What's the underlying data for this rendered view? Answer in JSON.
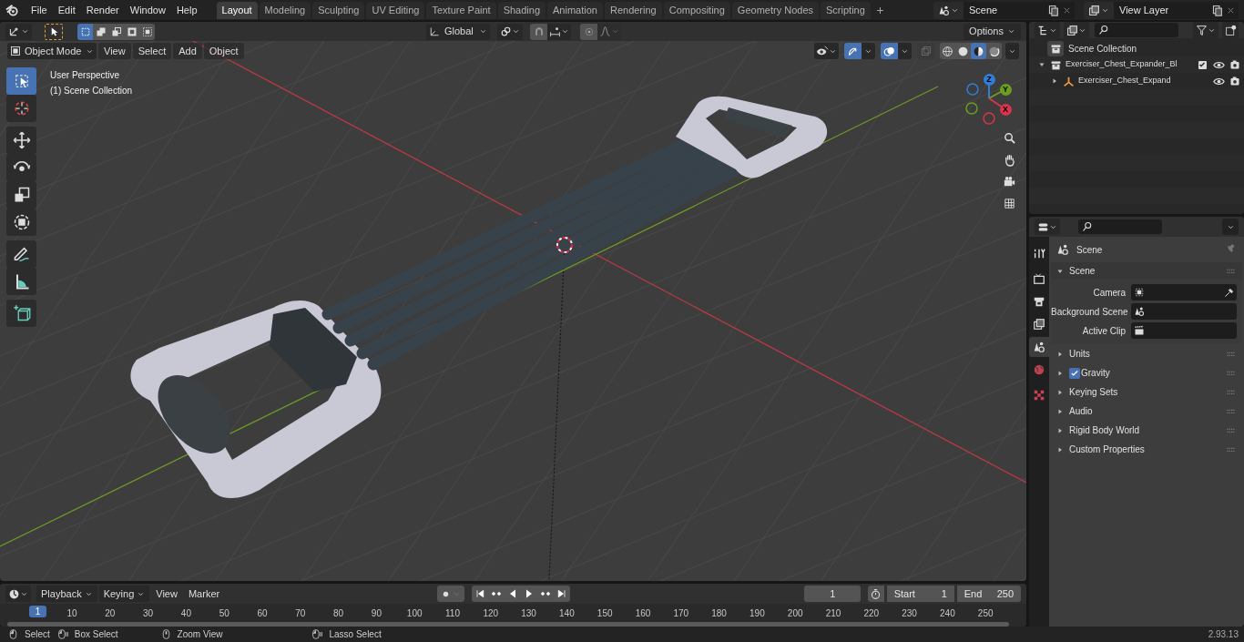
{
  "top_menu": [
    "File",
    "Edit",
    "Render",
    "Window",
    "Help"
  ],
  "workspaces": [
    {
      "label": "Layout",
      "selected": true
    },
    {
      "label": "Modeling",
      "selected": false
    },
    {
      "label": "Sculpting",
      "selected": false
    },
    {
      "label": "UV Editing",
      "selected": false
    },
    {
      "label": "Texture Paint",
      "selected": false
    },
    {
      "label": "Shading",
      "selected": false
    },
    {
      "label": "Animation",
      "selected": false
    },
    {
      "label": "Rendering",
      "selected": false
    },
    {
      "label": "Compositing",
      "selected": false
    },
    {
      "label": "Geometry Nodes",
      "selected": false
    },
    {
      "label": "Scripting",
      "selected": false
    }
  ],
  "scene_field": "Scene",
  "view_layer_field": "View Layer",
  "viewport": {
    "select_modes": [
      {
        "selected": true
      },
      {
        "selected": false
      },
      {
        "selected": false
      },
      {
        "selected": false
      },
      {
        "selected": false
      }
    ],
    "mode": "Object Mode",
    "menus": [
      "View",
      "Select",
      "Add",
      "Object"
    ],
    "orientation": "Global",
    "options": "Options",
    "info": [
      "User Perspective",
      "(1) Scene Collection"
    ],
    "tools": [
      {
        "kind": "select",
        "selected": true
      },
      {
        "kind": "cursor",
        "selected": false
      },
      {
        "kind": "move",
        "selected": false
      },
      {
        "kind": "rotate",
        "selected": false
      },
      {
        "kind": "scale",
        "selected": false
      },
      {
        "kind": "transform",
        "selected": false
      },
      {
        "kind": "annotate",
        "selected": false
      },
      {
        "kind": "measure",
        "selected": false
      },
      {
        "kind": "add-cube",
        "selected": false
      }
    ],
    "shading": [
      {
        "kind": "wireframe",
        "selected": false
      },
      {
        "kind": "solid",
        "selected": false
      },
      {
        "kind": "material",
        "selected": true
      },
      {
        "kind": "rendered",
        "selected": false
      }
    ],
    "axes": [
      {
        "label": "Z",
        "color": "#2f7fd8"
      },
      {
        "label": "Y",
        "color": "#6b9e1f"
      },
      {
        "label": "X",
        "color": "#d9344a"
      }
    ]
  },
  "outliner": {
    "root": "Scene Collection",
    "children": [
      {
        "label": "Exerciser_Chest_Expander_Bl",
        "kind": "collection",
        "expanded": true,
        "checked": true,
        "children": [
          {
            "label": "Exerciser_Chest_Expand",
            "kind": "empty",
            "expanded": false
          }
        ]
      }
    ]
  },
  "properties": {
    "tabs": [
      {
        "kind": "tool",
        "selected": false
      },
      {
        "kind": "render",
        "selected": false
      },
      {
        "kind": "output",
        "selected": false
      },
      {
        "kind": "view-layer",
        "selected": false
      },
      {
        "kind": "scene",
        "selected": true
      },
      {
        "kind": "world",
        "selected": false
      },
      {
        "kind": "texture",
        "selected": false
      }
    ],
    "context": "Scene",
    "panels": [
      {
        "label": "Scene",
        "expanded": true,
        "fields": [
          {
            "label": "Camera",
            "kind": "camera"
          },
          {
            "label": "Background Scene",
            "kind": "scene"
          },
          {
            "label": "Active Clip",
            "kind": "clip"
          }
        ]
      },
      {
        "label": "Units",
        "expanded": false
      },
      {
        "label": "Gravity",
        "expanded": false,
        "checked": true
      },
      {
        "label": "Keying Sets",
        "expanded": false
      },
      {
        "label": "Audio",
        "expanded": false
      },
      {
        "label": "Rigid Body World",
        "expanded": false
      },
      {
        "label": "Custom Properties",
        "expanded": false
      }
    ]
  },
  "timeline": {
    "menus": [
      "Playback",
      "Keying",
      "View",
      "Marker"
    ],
    "current_frame": "1",
    "start_label": "Start",
    "start": "1",
    "end_label": "End",
    "end": "250",
    "ruler_marker": "1",
    "ruler_ticks": [
      "10",
      "20",
      "30",
      "40",
      "50",
      "60",
      "70",
      "80",
      "90",
      "100",
      "110",
      "120",
      "130",
      "140",
      "150",
      "160",
      "170",
      "180",
      "190",
      "200",
      "210",
      "220",
      "230",
      "240",
      "250"
    ]
  },
  "status_bar": {
    "hints": [
      {
        "label": "Select",
        "kind": "left"
      },
      {
        "label": "Box Select",
        "kind": "drag"
      },
      {
        "label": "Zoom View",
        "kind": "middle"
      },
      {
        "label": "Lasso Select",
        "kind": "drag"
      }
    ],
    "version": "2.93.13"
  }
}
